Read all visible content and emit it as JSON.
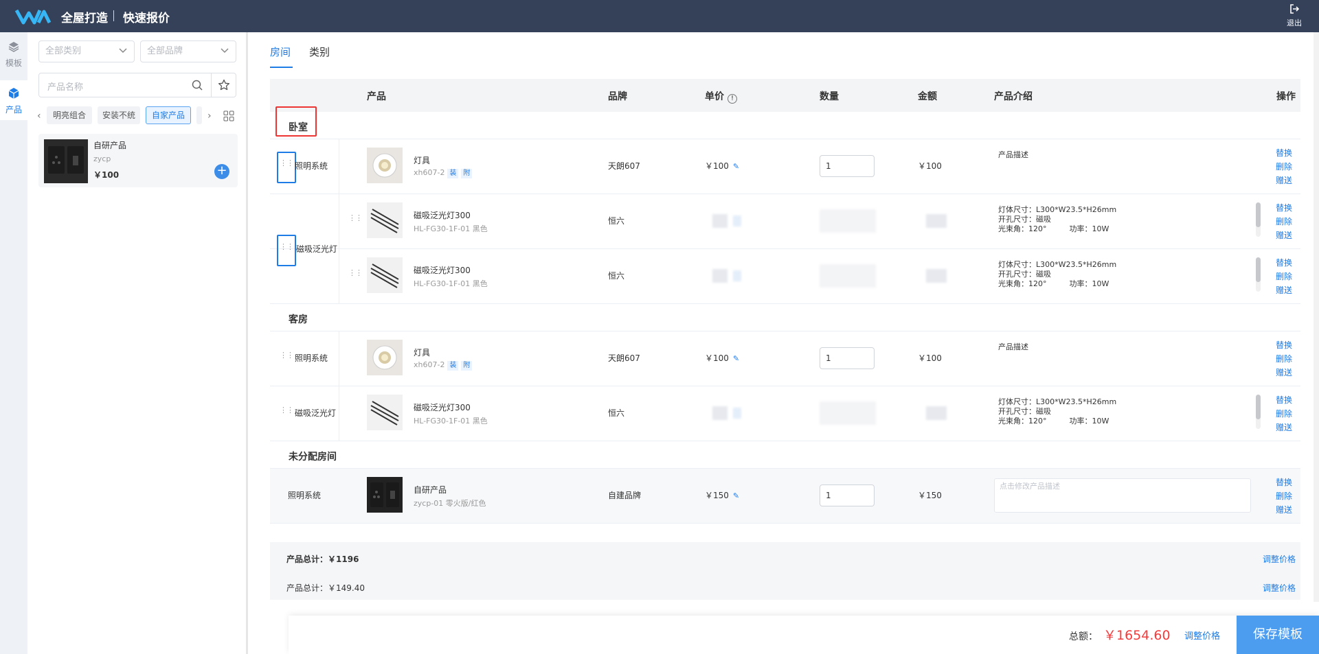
{
  "header": {
    "title": "全屋打造",
    "subtitle": "快速报价",
    "logout_label": "退出",
    "brand_color": "#354158"
  },
  "rail": {
    "items": [
      {
        "label": "模板",
        "icon": "layers-icon"
      },
      {
        "label": "产品",
        "icon": "cube-icon",
        "active": true
      }
    ]
  },
  "filters": {
    "category_placeholder": "全部类别",
    "brand_placeholder": "全部品牌",
    "search_placeholder": "产品名称",
    "chips": [
      "明亮组合",
      "安装不统",
      "自家产品"
    ],
    "active_chip": "自家产品"
  },
  "product_card": {
    "name": "自研产品",
    "code": "zycp",
    "price": "￥100",
    "add_label": "+"
  },
  "tabs": [
    {
      "label": "房间",
      "active": true
    },
    {
      "label": "类别",
      "active": false
    }
  ],
  "table": {
    "headers": {
      "product": "产品",
      "brand": "品牌",
      "unit_price": "单价",
      "quantity": "数量",
      "amount": "金额",
      "intro": "产品介绍",
      "ops": "操作"
    }
  },
  "ops": {
    "replace": "替换",
    "delete": "删除",
    "gift": "赠送"
  },
  "groups": [
    {
      "name": "卧室",
      "rows": [
        {
          "system": "照明系统",
          "name": "灯具",
          "code": "xh607-2",
          "tags": [
            "装",
            "附"
          ],
          "brand": "天朗607",
          "price": "￥100",
          "qty": "1",
          "amount": "￥100",
          "desc": "产品描述"
        },
        {
          "system": "磁吸泛光灯",
          "name": "磁吸泛光灯300",
          "code": "HL-FG30-1F-01 黑色",
          "brand": "恒六",
          "desc_lines": [
            "灯体尺寸：L300*W23.5*H26mm",
            "开孔尺寸：磁吸",
            "光束角：120°　　　功率：10W"
          ]
        },
        {
          "system": "",
          "name": "磁吸泛光灯300",
          "code": "HL-FG30-1F-01 黑色",
          "brand": "恒六",
          "desc_lines": [
            "灯体尺寸：L300*W23.5*H26mm",
            "开孔尺寸：磁吸",
            "光束角：120°　　　功率：10W"
          ]
        }
      ]
    },
    {
      "name": "客房",
      "rows": [
        {
          "system": "照明系统",
          "name": "灯具",
          "code": "xh607-2",
          "tags": [
            "装",
            "附"
          ],
          "brand": "天朗607",
          "price": "￥100",
          "qty": "1",
          "amount": "￥100",
          "desc": "产品描述"
        },
        {
          "system": "磁吸泛光灯",
          "name": "磁吸泛光灯300",
          "code": "HL-FG30-1F-01 黑色",
          "brand": "恒六",
          "desc_lines": [
            "灯体尺寸：L300*W23.5*H26mm",
            "开孔尺寸：磁吸",
            "光束角：120°　　　功率：10W"
          ]
        }
      ]
    },
    {
      "name": "未分配房间",
      "rows": [
        {
          "system": "照明系统",
          "name": "自研产品",
          "code": "zycp-01 零火版/红色",
          "brand": "自建品牌",
          "price": "￥150",
          "qty": "1",
          "amount": "￥150",
          "desc_placeholder": "点击修改产品描述"
        }
      ]
    }
  ],
  "totals": [
    {
      "label": "产品总计：",
      "value": "￥1196",
      "adjust": "调整价格"
    },
    {
      "label": "产品总计：",
      "value": "￥149.40",
      "adjust": "调整价格"
    }
  ],
  "footer": {
    "total_label": "总额：",
    "total_value": "￥1654.60",
    "adjust_label": "调整价格",
    "save_label": "保存模板",
    "accent": "#4c9df0",
    "total_color": "#f53b3b"
  }
}
